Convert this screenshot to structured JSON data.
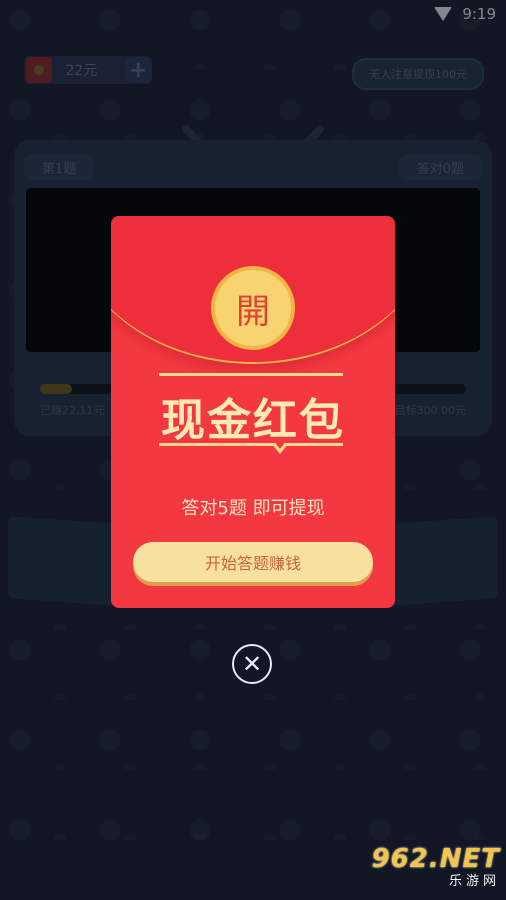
{
  "status_bar": {
    "time": "9:19",
    "wifi_icon": "wifi-icon"
  },
  "top_bar": {
    "coin_amount": "22元",
    "plus_label": "+",
    "notice_text": "无人注意提现100元"
  },
  "tv": {
    "question_label": "第1题",
    "correct_label": "答对0题",
    "progress_left": "已赚22.11元",
    "progress_right": "目标300.00元",
    "progress_fraction": 0.074
  },
  "red_packet": {
    "seal_char": "開",
    "title": "现金红包",
    "subtitle": "答对5题  即可提现",
    "start_button": "开始答题赚钱"
  },
  "close_icon": "close-icon",
  "watermark": {
    "top": "962.NET",
    "bottom": "乐游网"
  },
  "colors": {
    "packet_red": "#f43841",
    "gold": "#f7d46f",
    "button": "#f8e0a1"
  }
}
